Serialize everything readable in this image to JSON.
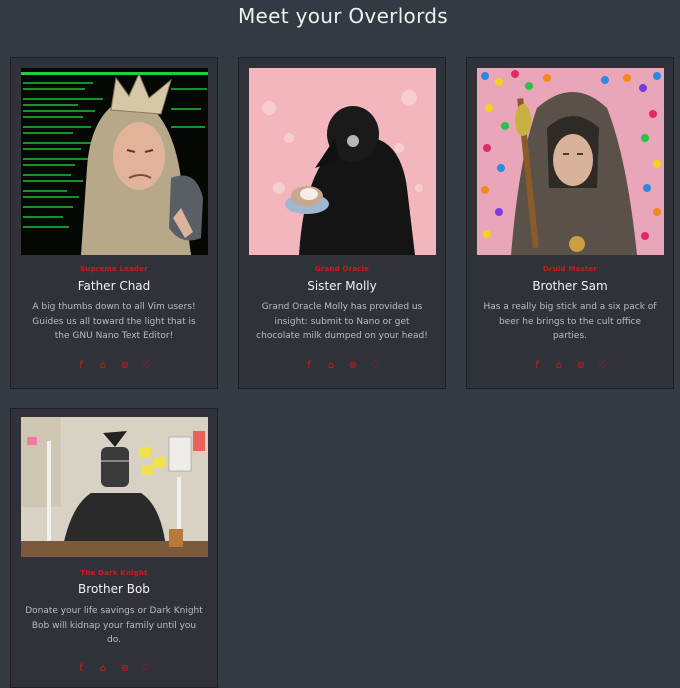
{
  "page": {
    "title": "Meet your Overlords"
  },
  "social_icons": [
    "facebook-icon",
    "github-icon",
    "dribbble-icon",
    "twitter-icon"
  ],
  "accent": "#d11a1a",
  "cards": [
    {
      "rank": "Supreme Leader",
      "name": "Father Chad",
      "description": "A big thumbs down to all Vim users! Guides us all toward the light that is the GNU Nano Text Editor!"
    },
    {
      "rank": "Grand Oracle",
      "name": "Sister Molly",
      "description": "Grand Oracle Molly has provided us insight: submit to Nano or get chocolate milk dumped on your head!"
    },
    {
      "rank": "Druid Master",
      "name": "Brother Sam",
      "description": "Has a really big stick and a six pack of beer he brings to the cult office parties."
    },
    {
      "rank": "The Dark Knight",
      "name": "Brother Bob",
      "description": "Donate your life savings or Dark Knight Bob will kidnap your family until you do."
    }
  ]
}
